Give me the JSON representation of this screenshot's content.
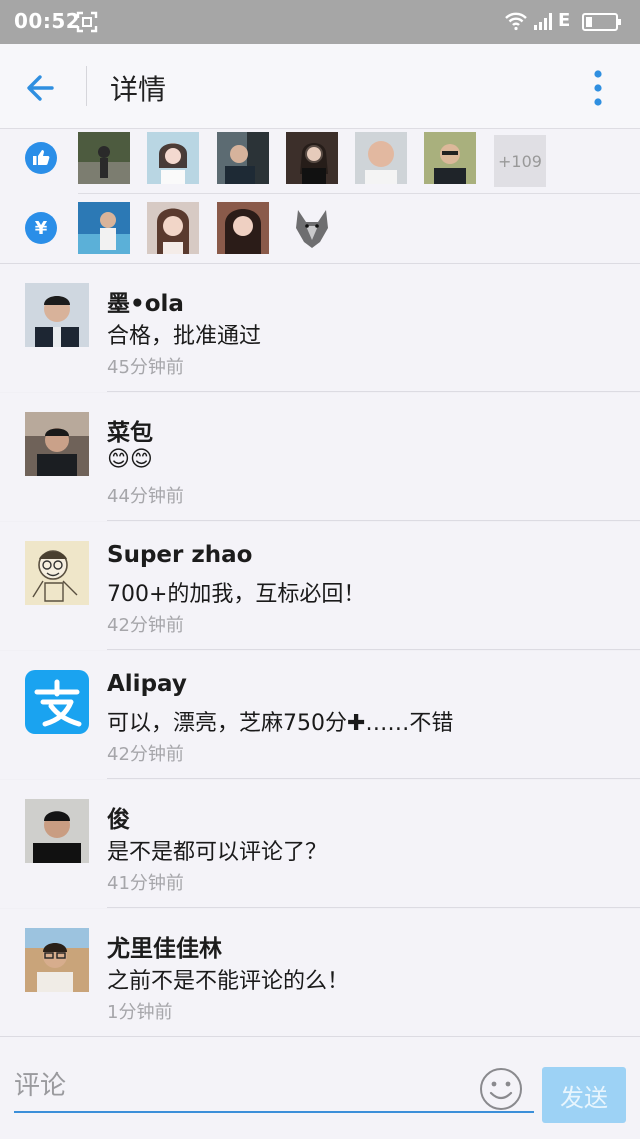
{
  "status_bar": {
    "time": "00:52",
    "network": "E"
  },
  "header": {
    "title": "详情"
  },
  "likes": {
    "icon": "thumbs-up-icon",
    "more_count": "+109",
    "color": "#2a8ee8"
  },
  "rewards": {
    "icon": "yuan-icon",
    "symbol": "¥"
  },
  "comments": [
    {
      "author": "墨•ola",
      "text": "合格，批准通过",
      "time": "45分钟前"
    },
    {
      "author": "菜包",
      "text": "😊😊",
      "time": "44分钟前"
    },
    {
      "author": "Super zhao",
      "text": "700+的加我，互标必回！",
      "time": "42分钟前"
    },
    {
      "author": "Alipay",
      "text": "可以，漂亮，芝麻750分✚……不错",
      "time": "42分钟前"
    },
    {
      "author": "俊",
      "text": "是不是都可以评论了？",
      "time": "41分钟前"
    },
    {
      "author": "尤里佳佳林",
      "text": "之前不是不能评论的么！",
      "time": "1分钟前"
    }
  ],
  "input": {
    "placeholder": "评论",
    "send_label": "发送"
  },
  "colors": {
    "accent": "#2a8ee8",
    "send_button": "#9dd2f5",
    "alipay": "#1aa3f0"
  }
}
